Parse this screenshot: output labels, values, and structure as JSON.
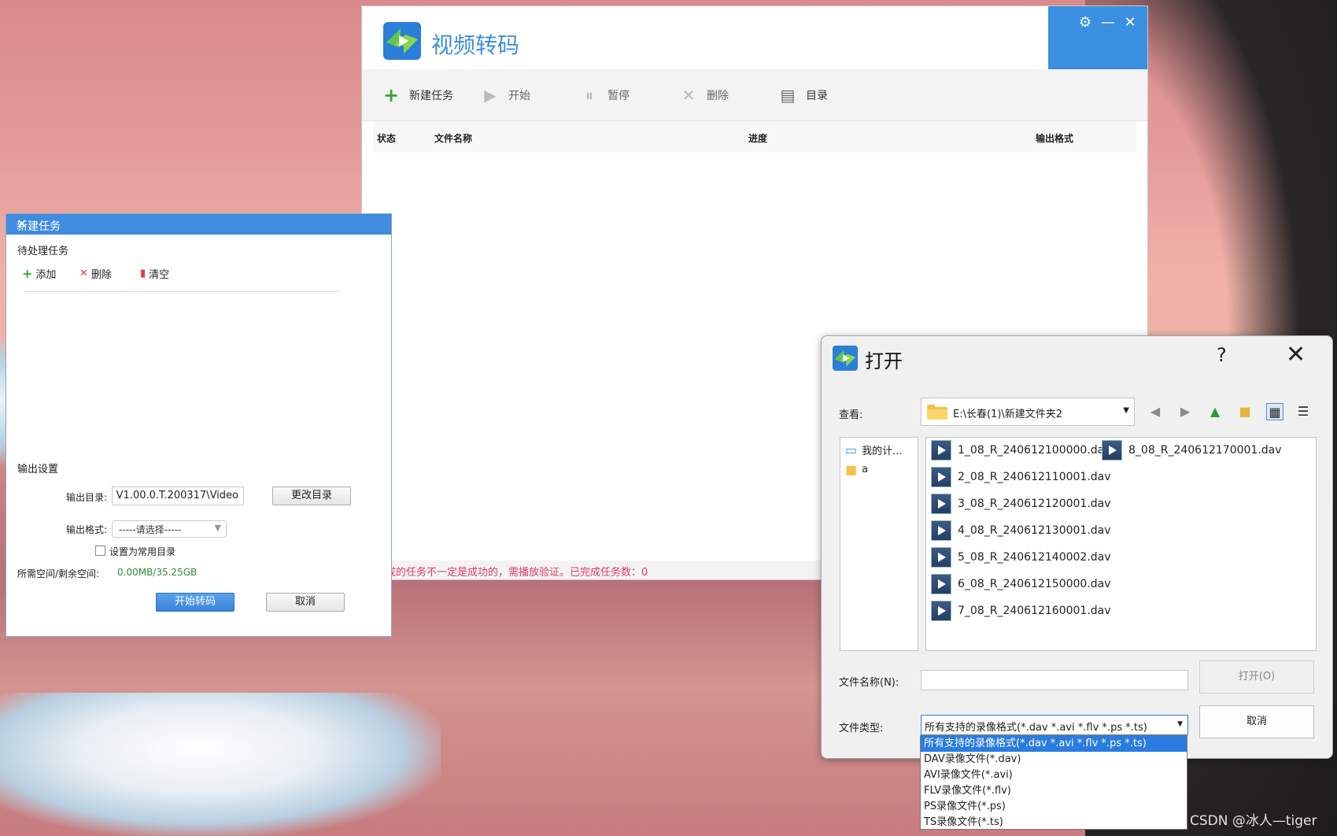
{
  "main_window": {
    "title": "视频转码",
    "header_buttons": [
      "gear-icon",
      "minimize-icon",
      "close-icon"
    ],
    "toolbar": {
      "new_task": "新建任务",
      "start": "开始",
      "pause": "暂停",
      "delete": "删除",
      "directory": "目录"
    },
    "grid_headers": {
      "status": "状态",
      "file_name": "文件名称",
      "progress": "进度",
      "output_format": "输出格式"
    },
    "status_message": "成的任务不一定是成功的，需播放验证。已完成任务数：0"
  },
  "task_dialog": {
    "title": "新建任务",
    "close": "×",
    "pending_label": "待处理任务",
    "add": "添加",
    "delete": "删除",
    "clear": "清空",
    "output_settings": "输出设置",
    "output_dir_label": "输出目录:",
    "output_dir_value": "V1.00.0.T.200317\\Video",
    "change_dir": "更改目录",
    "output_format_label": "输出格式:",
    "output_format_value": "-----请选择-----",
    "set_common_dir": "设置为常用目录",
    "space_label": "所需空间/剩余空间:",
    "space_value": "0.00MB/35.25GB",
    "start_transcode": "开始转码",
    "cancel": "取消"
  },
  "open_dialog": {
    "title": "打开",
    "help": "?",
    "look_in_label": "查看:",
    "look_in_path": "E:\\长春(1)\\新建文件夹2",
    "sidebar": [
      "我的计...",
      "a"
    ],
    "files": [
      "1_08_R_240612100000.dav",
      "2_08_R_240612110001.dav",
      "3_08_R_240612120001.dav",
      "4_08_R_240612130001.dav",
      "5_08_R_240612140002.dav",
      "6_08_R_240612150000.dav",
      "7_08_R_240612160001.dav",
      "8_08_R_240612170001.dav"
    ],
    "file_name_label": "文件名称(N):",
    "file_name_value": "",
    "open_button": "打开(O)",
    "cancel_button": "取消",
    "file_type_label": "文件类型:",
    "file_type_value": "所有支持的录像格式(*.dav *.avi *.flv *.ps *.ts)",
    "file_type_options": [
      "所有支持的录像格式(*.dav *.avi *.flv *.ps *.ts)",
      "DAV录像文件(*.dav)",
      "AVI录像文件(*.avi)",
      "FLV录像文件(*.flv)",
      "PS录像文件(*.ps)",
      "TS录像文件(*.ts)"
    ]
  },
  "watermark": "CSDN @冰人—tiger",
  "colors": {
    "accent": "#3a8fe0",
    "status_red": "#e03c62",
    "space_green": "#2e8b3a"
  }
}
